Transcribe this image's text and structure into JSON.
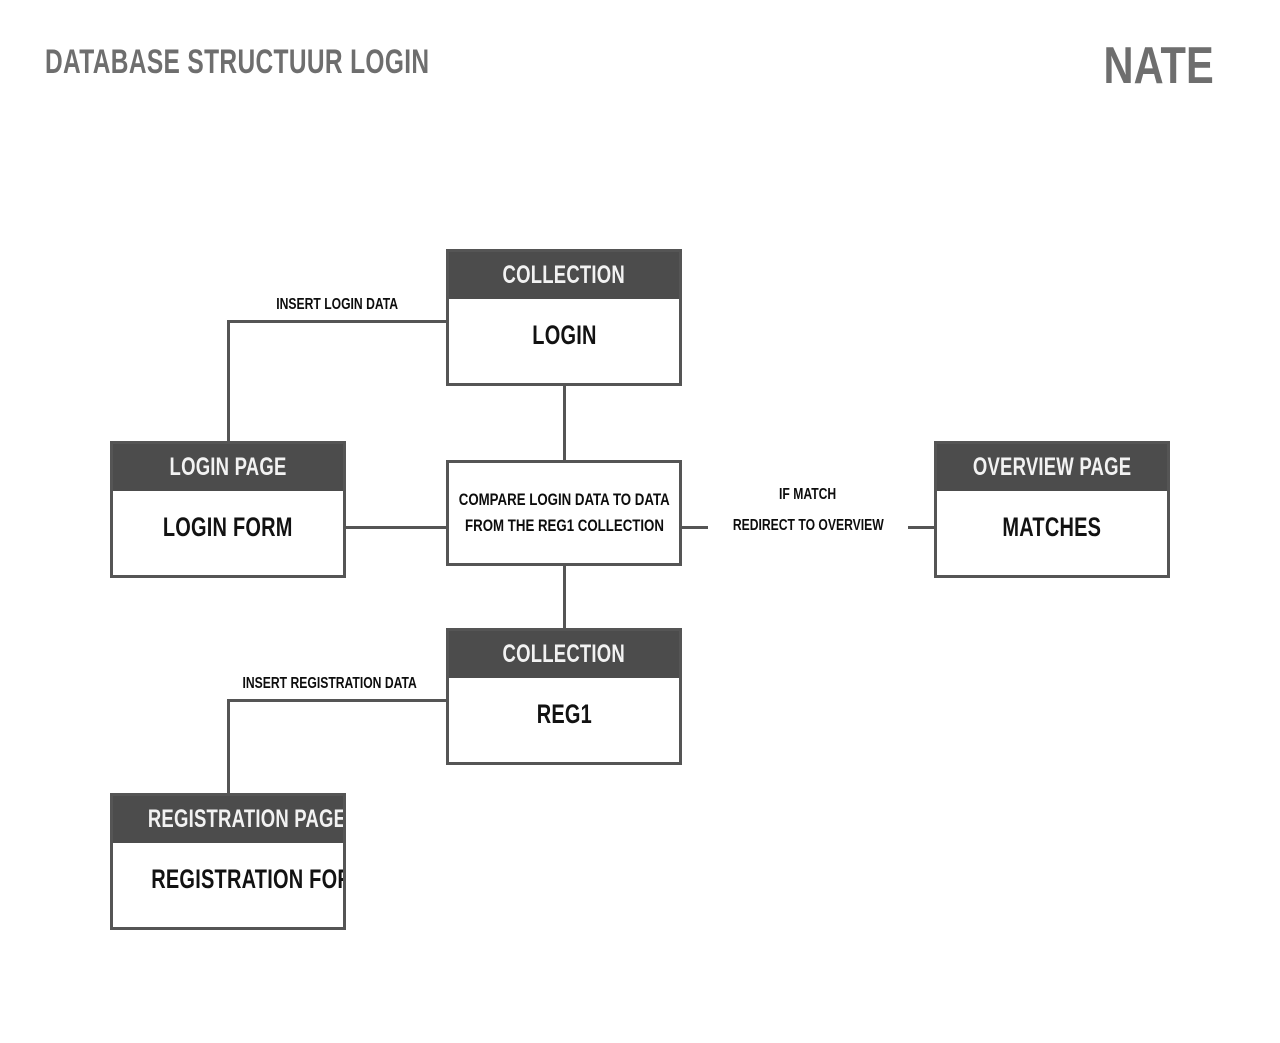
{
  "header": {
    "title": "DATABASE STRUCTUUR LOGIN",
    "brand": "NATE"
  },
  "nodes": {
    "collection_login": {
      "header": "COLLECTION",
      "body": "LOGIN"
    },
    "login_page": {
      "header": "LOGIN PAGE",
      "body": "LOGIN FORM"
    },
    "compare": {
      "line1": "COMPARE LOGIN DATA TO DATA",
      "line2": "FROM THE REG1 COLLECTION"
    },
    "overview_page": {
      "header": "OVERVIEW PAGE",
      "body": "MATCHES"
    },
    "collection_reg1": {
      "header": "COLLECTION",
      "body": "REG1"
    },
    "registration_page": {
      "header": "REGISTRATION PAGE",
      "body": "REGISTRATION FORM"
    }
  },
  "edges": {
    "insert_login_data": "INSERT LOGIN DATA",
    "if_match": "IF MATCH",
    "redirect_to_overview": "REDIRECT TO OVERVIEW",
    "insert_registration_data": "INSERT REGISTRATION DATA"
  },
  "colors": {
    "header_fill": "#4c4c4c",
    "border": "#555555",
    "title_gray": "#6e6e6e",
    "text_black": "#0d0d0d",
    "background": "#ffffff"
  }
}
